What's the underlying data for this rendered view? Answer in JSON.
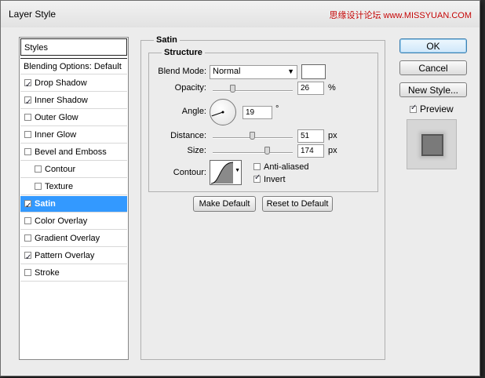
{
  "window": {
    "title": "Layer Style",
    "watermark": "思缘设计论坛 www.MISSYUAN.COM"
  },
  "sidebar": {
    "header": "Styles",
    "blending_options": "Blending Options: Default",
    "items": [
      {
        "label": "Drop Shadow",
        "checked": true,
        "indent": false
      },
      {
        "label": "Inner Shadow",
        "checked": true,
        "indent": false
      },
      {
        "label": "Outer Glow",
        "checked": false,
        "indent": false
      },
      {
        "label": "Inner Glow",
        "checked": false,
        "indent": false
      },
      {
        "label": "Bevel and Emboss",
        "checked": false,
        "indent": false
      },
      {
        "label": "Contour",
        "checked": false,
        "indent": true
      },
      {
        "label": "Texture",
        "checked": false,
        "indent": true
      },
      {
        "label": "Satin",
        "checked": true,
        "indent": false,
        "selected": true
      },
      {
        "label": "Color Overlay",
        "checked": false,
        "indent": false
      },
      {
        "label": "Gradient Overlay",
        "checked": false,
        "indent": false
      },
      {
        "label": "Pattern Overlay",
        "checked": true,
        "indent": false
      },
      {
        "label": "Stroke",
        "checked": false,
        "indent": false
      }
    ]
  },
  "satin": {
    "group_label": "Satin",
    "structure_label": "Structure",
    "blend_mode_label": "Blend Mode:",
    "blend_mode_value": "Normal",
    "blend_color": "#ffffff",
    "opacity_label": "Opacity:",
    "opacity_value": "26",
    "opacity_fraction": 0.26,
    "opacity_unit": "%",
    "angle_label": "Angle:",
    "angle_value": "19",
    "angle_unit": "°",
    "distance_label": "Distance:",
    "distance_value": "51",
    "distance_unit": "px",
    "distance_fraction": 0.51,
    "size_label": "Size:",
    "size_value": "174",
    "size_unit": "px",
    "size_fraction": 0.7,
    "contour_label": "Contour:",
    "anti_aliased_label": "Anti-aliased",
    "anti_aliased_checked": false,
    "invert_label": "Invert",
    "invert_checked": true,
    "make_default": "Make Default",
    "reset_default": "Reset to Default"
  },
  "actions": {
    "ok": "OK",
    "cancel": "Cancel",
    "new_style": "New Style...",
    "preview_label": "Preview",
    "preview_checked": true
  },
  "colors": {
    "selected_row": "#3399ff",
    "dialog_bg": "#ececec"
  }
}
